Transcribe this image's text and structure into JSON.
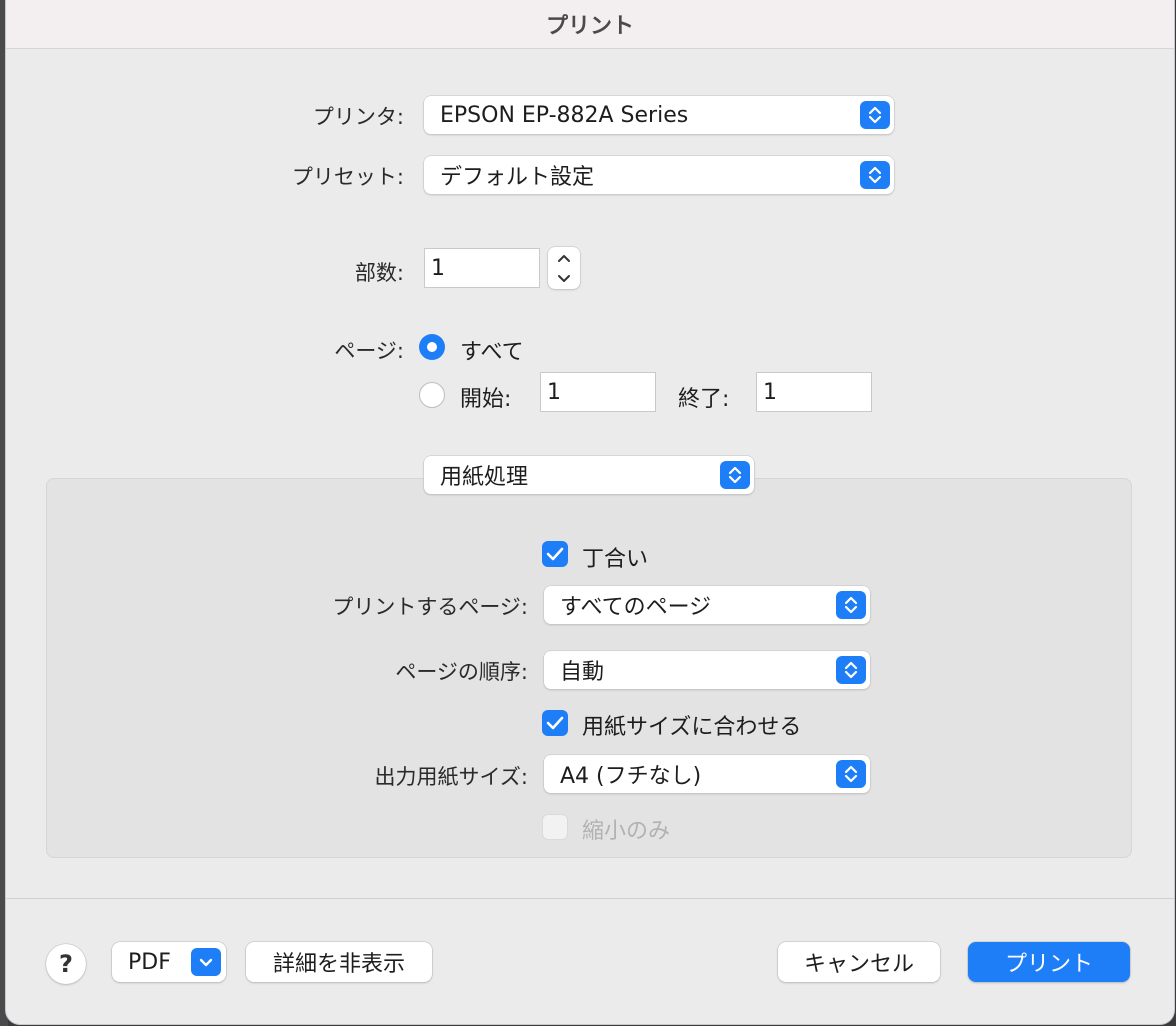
{
  "dialog": {
    "title": "プリント"
  },
  "printer": {
    "label": "プリンタ:",
    "value": "EPSON EP-882A Series"
  },
  "preset": {
    "label": "プリセット:",
    "value": "デフォルト設定"
  },
  "copies": {
    "label": "部数:",
    "value": "1"
  },
  "pages": {
    "label": "ページ:",
    "all_label": "すべて",
    "all_selected": true,
    "from_label": "開始:",
    "from_value": "1",
    "to_label": "終了:",
    "to_value": "1"
  },
  "section_menu": {
    "value": "用紙処理"
  },
  "paper_handling": {
    "collate_label": "丁合い",
    "collate_checked": true,
    "pages_to_print_label": "プリントするページ:",
    "pages_to_print_value": "すべてのページ",
    "page_order_label": "ページの順序:",
    "page_order_value": "自動",
    "scale_to_fit_label": "用紙サイズに合わせる",
    "scale_to_fit_checked": true,
    "dest_paper_size_label": "出力用紙サイズ:",
    "dest_paper_size_value": "A4 (フチなし)",
    "scale_down_only_label": "縮小のみ",
    "scale_down_only_checked": false
  },
  "footer": {
    "help_label": "?",
    "pdf_label": "PDF",
    "hide_details_label": "詳細を非表示",
    "cancel_label": "キャンセル",
    "print_label": "プリント"
  },
  "colors": {
    "accent": "#1e7ef7",
    "dialog_bg": "#ebebeb",
    "titlebar_bg": "#f3eff0"
  },
  "icons": {
    "popup_indicator": "updown-chevron-icon",
    "check": "checkmark-icon",
    "pdf_menu": "chevron-down-icon"
  }
}
